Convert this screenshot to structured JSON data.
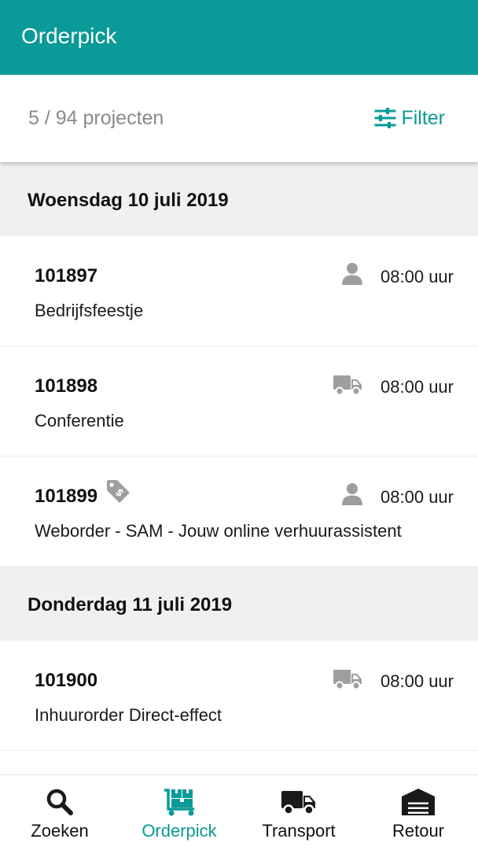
{
  "app": {
    "title": "Orderpick"
  },
  "summary": {
    "count_text": "5 / 94 projecten",
    "filter_label": "Filter",
    "filter_icon": "sliders-icon"
  },
  "groups": [
    {
      "date": "Woensdag 10 juli 2019",
      "orders": [
        {
          "number": "101897",
          "description": "Bedrijfsfeestje",
          "time": "08:00 uur",
          "kind_icon": "person-icon"
        },
        {
          "number": "101898",
          "description": "Conferentie",
          "time": "08:00 uur",
          "kind_icon": "truck-icon"
        },
        {
          "number": "101899",
          "description": "Weborder - SAM - Jouw online verhuurassistent",
          "time": "08:00 uur",
          "kind_icon": "person-icon",
          "badge_icon": "price-tag-icon"
        }
      ]
    },
    {
      "date": "Donderdag 11 juli 2019",
      "orders": [
        {
          "number": "101900",
          "description": "Inhuurorder Direct-effect",
          "time": "08:00 uur",
          "kind_icon": "truck-icon"
        }
      ]
    }
  ],
  "nav": [
    {
      "label": "Zoeken",
      "icon": "search-icon",
      "active": false
    },
    {
      "label": "Orderpick",
      "icon": "pallet-cart-icon",
      "active": true
    },
    {
      "label": "Transport",
      "icon": "truck-icon",
      "active": false
    },
    {
      "label": "Retour",
      "icon": "warehouse-icon",
      "active": false
    }
  ],
  "colors": {
    "primary": "#0a9a97",
    "header_bg": "#f0f0f0",
    "icon_gray": "#9e9e9e"
  }
}
